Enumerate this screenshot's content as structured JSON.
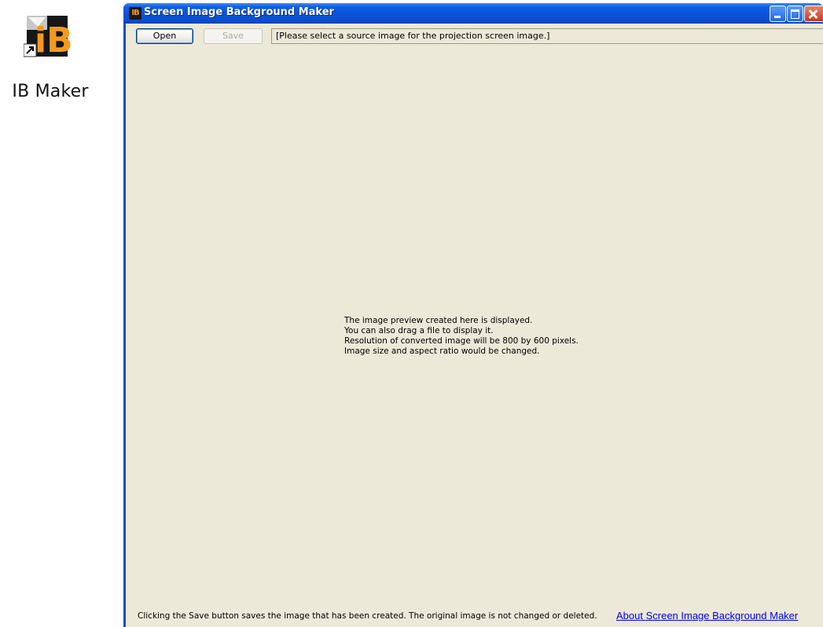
{
  "desktop": {
    "shortcut": {
      "label": "IB Maker",
      "icon": "ib-maker-app-icon",
      "icon_text": "iB",
      "overlay_icon": "shortcut-arrow-icon"
    }
  },
  "window": {
    "title": "Screen Image Background Maker",
    "app_icon_text": "IB",
    "controls": [
      "minimize-icon",
      "maximize-icon",
      "close-icon"
    ],
    "toolbar": {
      "open_label": "Open",
      "save_label": "Save",
      "save_enabled": false,
      "path_text": "[Please select a source image for the projection screen image.]"
    },
    "preview": {
      "lines": [
        "The image preview created here is displayed.",
        "You can also drag a file to display it.",
        "Resolution of converted image will be 800 by 600 pixels.",
        "Image size and aspect ratio would be changed."
      ]
    },
    "footer": {
      "note": "Clicking the Save button saves the image that has been created. The original image is not changed or deleted.",
      "about_link": "About Screen Image Background Maker"
    }
  },
  "colors": {
    "titlebar": "#0a53d8",
    "client_bg": "#ece9d8",
    "link": "#0000ee",
    "icon_orange": "#f39a1e"
  }
}
